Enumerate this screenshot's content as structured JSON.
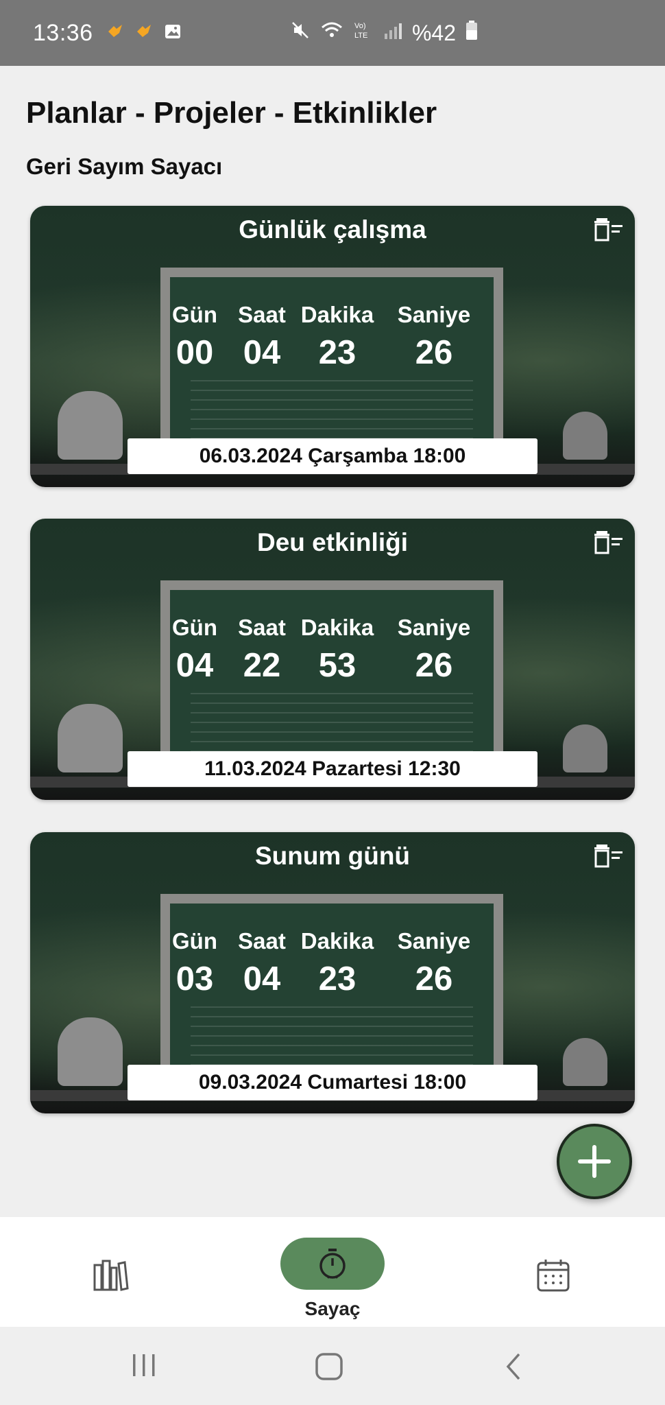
{
  "status_bar": {
    "time": "13:36",
    "battery": "%42",
    "network": "LTE"
  },
  "header": {
    "title": "Planlar - Projeler - Etkinlikler",
    "subtitle": "Geri Sayım Sayacı"
  },
  "unit_labels": {
    "days": "Gün",
    "hours": "Saat",
    "minutes": "Dakika",
    "seconds": "Saniye"
  },
  "countdowns": [
    {
      "title": "Günlük çalışma",
      "days": "00",
      "hours": "04",
      "minutes": "23",
      "seconds": "26",
      "date": "06.03.2024 Çarşamba 18:00"
    },
    {
      "title": "Deu etkinliği",
      "days": "04",
      "hours": "22",
      "minutes": "53",
      "seconds": "26",
      "date": "11.03.2024 Pazartesi 12:30"
    },
    {
      "title": "Sunum günü",
      "days": "03",
      "hours": "04",
      "minutes": "23",
      "seconds": "26",
      "date": "09.03.2024 Cumartesi 18:00"
    }
  ],
  "bottom_nav": {
    "items": [
      {
        "icon": "books-icon",
        "label": ""
      },
      {
        "icon": "timer-icon",
        "label": "Sayaç",
        "active": true
      },
      {
        "icon": "calendar-icon",
        "label": ""
      }
    ],
    "active_color": "#5a8a5c"
  },
  "fab": {
    "icon": "plus-icon",
    "color": "#5a8a5c"
  }
}
